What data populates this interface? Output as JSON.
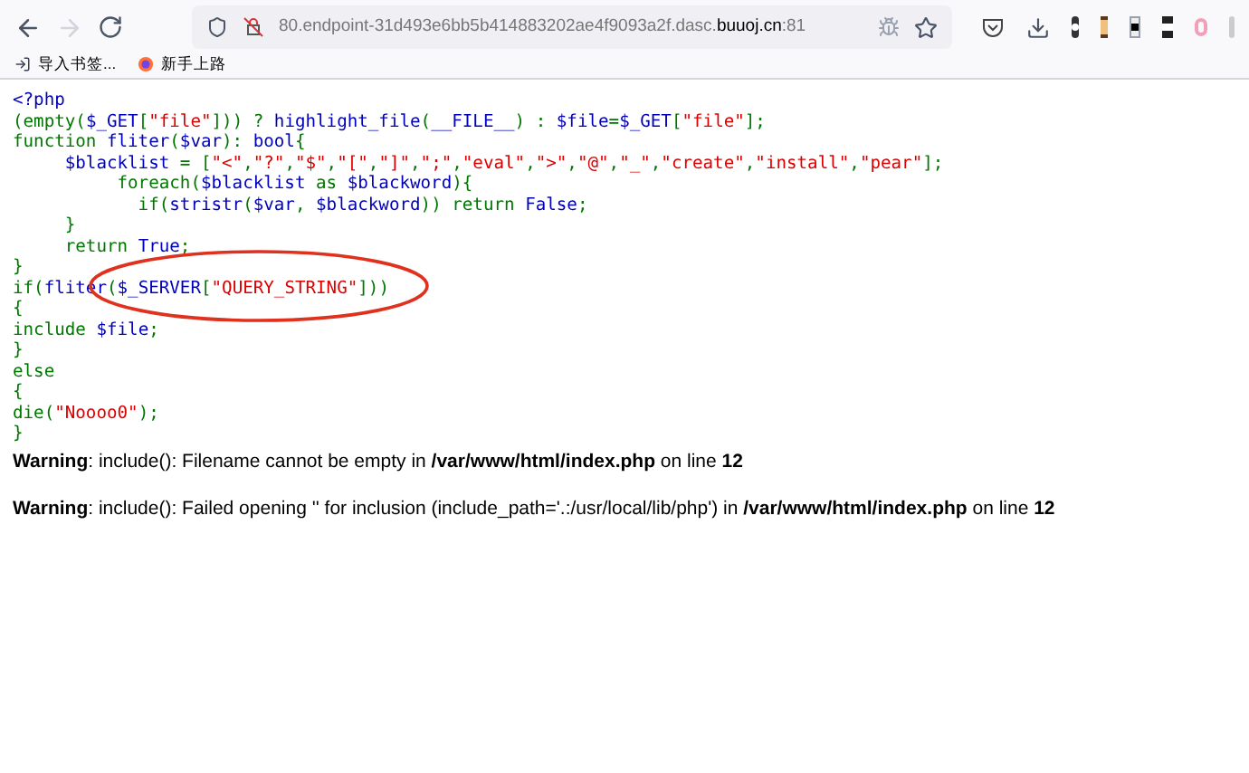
{
  "browser": {
    "url": "80.endpoint-31d493e6bb5b414883202ae4f9093a2f.dasc.**buuoj.cn**:81",
    "bookmarks": [
      {
        "label": "导入书签..."
      },
      {
        "label": "新手上路"
      }
    ]
  },
  "code_lines": [
    [
      {
        "text": "<?php",
        "kind": "default"
      }
    ],
    [
      {
        "text": "(empty(",
        "kind": "keyword"
      },
      {
        "text": "$_GET",
        "kind": "default"
      },
      {
        "text": "[",
        "kind": "keyword"
      },
      {
        "text": "\"file\"",
        "kind": "string"
      },
      {
        "text": "])) ? ",
        "kind": "keyword"
      },
      {
        "text": "highlight_file",
        "kind": "default"
      },
      {
        "text": "(",
        "kind": "keyword"
      },
      {
        "text": "__FILE__",
        "kind": "default"
      },
      {
        "text": ") : ",
        "kind": "keyword"
      },
      {
        "text": "$file",
        "kind": "default"
      },
      {
        "text": "=",
        "kind": "keyword"
      },
      {
        "text": "$_GET",
        "kind": "default"
      },
      {
        "text": "[",
        "kind": "keyword"
      },
      {
        "text": "\"file\"",
        "kind": "string"
      },
      {
        "text": "];",
        "kind": "keyword"
      }
    ],
    [
      {
        "text": "function ",
        "kind": "keyword"
      },
      {
        "text": "fliter",
        "kind": "default"
      },
      {
        "text": "(",
        "kind": "keyword"
      },
      {
        "text": "$var",
        "kind": "default"
      },
      {
        "text": "): ",
        "kind": "keyword"
      },
      {
        "text": "bool",
        "kind": "default"
      },
      {
        "text": "{",
        "kind": "keyword"
      }
    ],
    [
      {
        "text": "     $blacklist ",
        "kind": "default"
      },
      {
        "text": "= [",
        "kind": "keyword"
      },
      {
        "text": "\"<\"",
        "kind": "string"
      },
      {
        "text": ",",
        "kind": "keyword"
      },
      {
        "text": "\"?\"",
        "kind": "string"
      },
      {
        "text": ",",
        "kind": "keyword"
      },
      {
        "text": "\"$\"",
        "kind": "string"
      },
      {
        "text": ",",
        "kind": "keyword"
      },
      {
        "text": "\"[\"",
        "kind": "string"
      },
      {
        "text": ",",
        "kind": "keyword"
      },
      {
        "text": "\"]\"",
        "kind": "string"
      },
      {
        "text": ",",
        "kind": "keyword"
      },
      {
        "text": "\";\"",
        "kind": "string"
      },
      {
        "text": ",",
        "kind": "keyword"
      },
      {
        "text": "\"eval\"",
        "kind": "string"
      },
      {
        "text": ",",
        "kind": "keyword"
      },
      {
        "text": "\">\"",
        "kind": "string"
      },
      {
        "text": ",",
        "kind": "keyword"
      },
      {
        "text": "\"@\"",
        "kind": "string"
      },
      {
        "text": ",",
        "kind": "keyword"
      },
      {
        "text": "\"_\"",
        "kind": "string"
      },
      {
        "text": ",",
        "kind": "keyword"
      },
      {
        "text": "\"create\"",
        "kind": "string"
      },
      {
        "text": ",",
        "kind": "keyword"
      },
      {
        "text": "\"install\"",
        "kind": "string"
      },
      {
        "text": ",",
        "kind": "keyword"
      },
      {
        "text": "\"pear\"",
        "kind": "string"
      },
      {
        "text": "];",
        "kind": "keyword"
      }
    ],
    [
      {
        "text": "          foreach(",
        "kind": "keyword"
      },
      {
        "text": "$blacklist ",
        "kind": "default"
      },
      {
        "text": "as ",
        "kind": "keyword"
      },
      {
        "text": "$blackword",
        "kind": "default"
      },
      {
        "text": "){",
        "kind": "keyword"
      }
    ],
    [
      {
        "text": "            if(",
        "kind": "keyword"
      },
      {
        "text": "stristr",
        "kind": "default"
      },
      {
        "text": "(",
        "kind": "keyword"
      },
      {
        "text": "$var",
        "kind": "default"
      },
      {
        "text": ", ",
        "kind": "keyword"
      },
      {
        "text": "$blackword",
        "kind": "default"
      },
      {
        "text": ")) return ",
        "kind": "keyword"
      },
      {
        "text": "False",
        "kind": "default"
      },
      {
        "text": ";",
        "kind": "keyword"
      }
    ],
    [
      {
        "text": "     }",
        "kind": "keyword"
      }
    ],
    [
      {
        "text": "     return ",
        "kind": "keyword"
      },
      {
        "text": "True",
        "kind": "default"
      },
      {
        "text": ";",
        "kind": "keyword"
      }
    ],
    [
      {
        "text": "}",
        "kind": "keyword"
      }
    ],
    [
      {
        "text": "if(",
        "kind": "keyword"
      },
      {
        "text": "fliter",
        "kind": "default"
      },
      {
        "text": "(",
        "kind": "keyword"
      },
      {
        "text": "$_SERVER",
        "kind": "default"
      },
      {
        "text": "[",
        "kind": "keyword"
      },
      {
        "text": "\"QUERY_STRING\"",
        "kind": "string"
      },
      {
        "text": "]))",
        "kind": "keyword"
      }
    ],
    [
      {
        "text": "{",
        "kind": "keyword"
      }
    ],
    [
      {
        "text": "include ",
        "kind": "keyword"
      },
      {
        "text": "$file",
        "kind": "default"
      },
      {
        "text": ";",
        "kind": "keyword"
      }
    ],
    [
      {
        "text": "}",
        "kind": "keyword"
      }
    ],
    [
      {
        "text": "else",
        "kind": "keyword"
      }
    ],
    [
      {
        "text": "{",
        "kind": "keyword"
      }
    ],
    [
      {
        "text": "die(",
        "kind": "keyword"
      },
      {
        "text": "\"Noooo0\"",
        "kind": "string"
      },
      {
        "text": ");",
        "kind": "keyword"
      }
    ],
    [
      {
        "text": "}",
        "kind": "keyword"
      }
    ]
  ],
  "warnings": [
    "**Warning**: include(): Filename cannot be empty in **/var/www/html/index.php** on line **12**",
    "**Warning**: include(): Failed opening '' for inclusion (include_path='.:/usr/local/lib/php') in **/var/www/html/index.php** on line **12**"
  ]
}
